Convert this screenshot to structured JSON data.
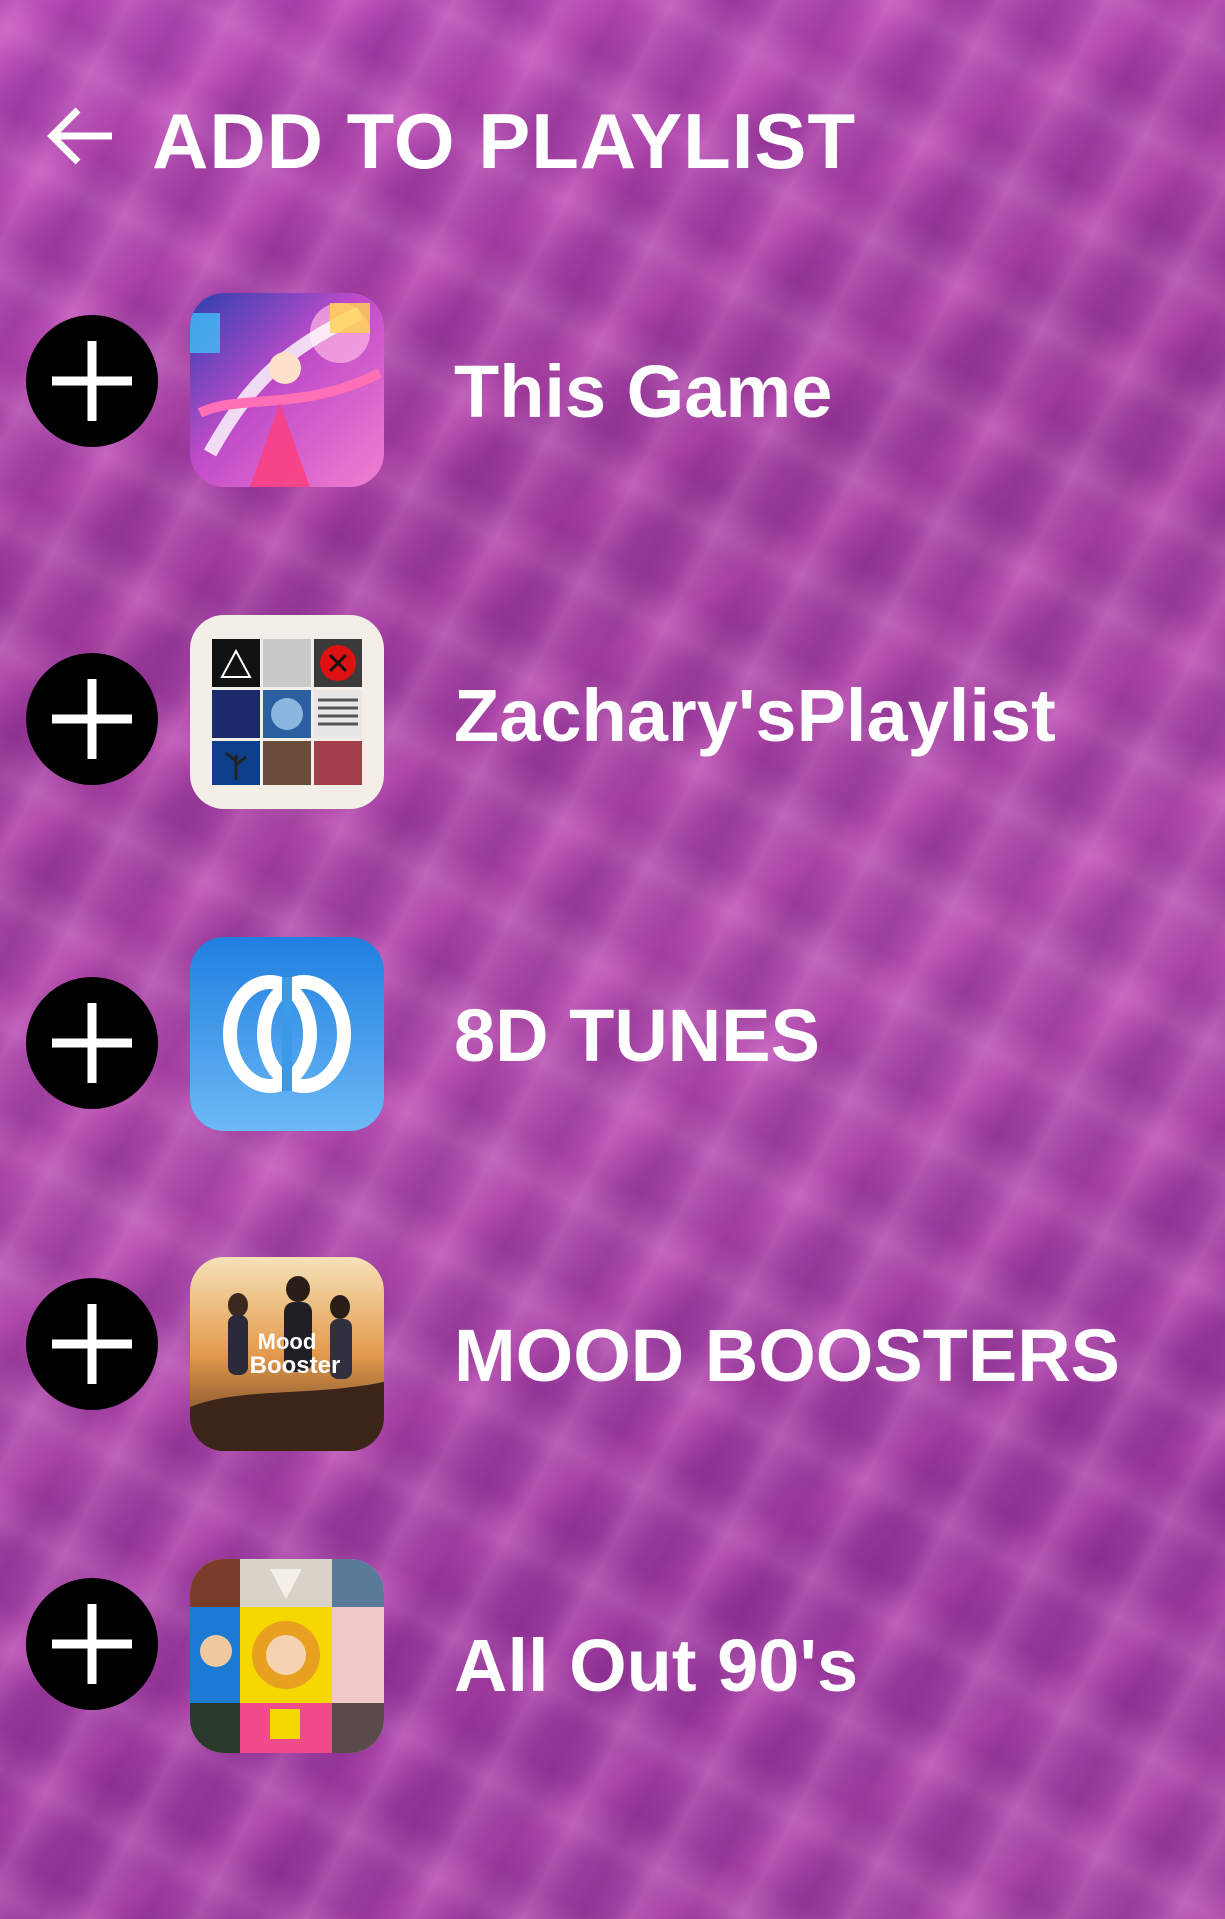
{
  "header": {
    "back_icon": "arrow-left-icon",
    "title": "ADD TO PLAYLIST"
  },
  "playlists": [
    {
      "name": "This Game",
      "add_icon": "plus-icon",
      "cover": "anime-art-cover"
    },
    {
      "name": "Zachary'sPlaylist",
      "add_icon": "plus-icon",
      "cover": "album-collage-cover"
    },
    {
      "name": "8D TUNES",
      "add_icon": "plus-icon",
      "cover": "8d-logo-cover"
    },
    {
      "name": "MOOD BOOSTERS",
      "add_icon": "plus-icon",
      "cover": "mood-booster-cover",
      "cover_text_1": "Mood",
      "cover_text_2": "Booster"
    },
    {
      "name": "All Out 90's",
      "add_icon": "plus-icon",
      "cover": "90s-collage-cover"
    }
  ],
  "colors": {
    "text": "#ffffff",
    "add_button_bg": "#000000",
    "background_base": "#a84aa9"
  }
}
